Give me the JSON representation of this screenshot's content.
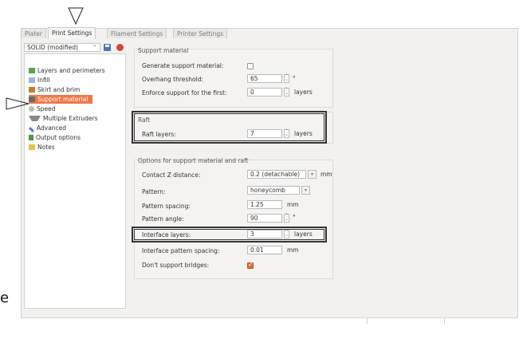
{
  "tabs": [
    "Plater",
    "Print Settings",
    "Filament Settings",
    "Printer Settings"
  ],
  "active_tab": "Print Settings",
  "preset": {
    "value": "SOLID (modified)",
    "arrow": "⌃"
  },
  "tree": [
    {
      "label": "Layers and perimeters",
      "icon": "layers-icon",
      "color": "#5aa34a"
    },
    {
      "label": "Infill",
      "icon": "infill-icon",
      "color": "#9bb6d8"
    },
    {
      "label": "Skirt and brim",
      "icon": "skirt-icon",
      "color": "#c67d2f"
    },
    {
      "label": "Support material",
      "icon": "support-icon",
      "color": "#6b6b6b",
      "selected": true
    },
    {
      "label": "Speed",
      "icon": "speed-icon",
      "color": "#8c8c8c"
    },
    {
      "label": "Multiple Extruders",
      "icon": "funnel-icon",
      "color": "#777"
    },
    {
      "label": "Advanced",
      "icon": "wrench-icon",
      "color": "#5a7dbf"
    },
    {
      "label": "Output options",
      "icon": "output-icon",
      "color": "#4a9b3a"
    },
    {
      "label": "Notes",
      "icon": "notes-icon",
      "color": "#e8c34a"
    }
  ],
  "support": {
    "title": "Support material",
    "generate_label": "Generate support material:",
    "overhang_label": "Overhang threshold:",
    "overhang_value": "65",
    "overhang_unit": "°",
    "enforce_label": "Enforce support for the first:",
    "enforce_value": "0",
    "enforce_unit": "layers"
  },
  "raft": {
    "title": "Raft",
    "layers_label": "Raft layers:",
    "layers_value": "7",
    "layers_unit": "layers"
  },
  "options": {
    "title": "Options for support material and raft",
    "contact_label": "Contact Z distance:",
    "contact_value": "0.2 (detachable)",
    "contact_unit": "mm",
    "pattern_label": "Pattern:",
    "pattern_value": "honeycomb",
    "spacing_label": "Pattern spacing:",
    "spacing_value": "1.25",
    "spacing_unit": "mm",
    "angle_label": "Pattern angle:",
    "angle_value": "90",
    "angle_unit": "°",
    "interface_label": "Interface layers:",
    "interface_value": "3",
    "interface_unit": "layers",
    "interface_spacing_label": "Interface pattern spacing:",
    "interface_spacing_value": "0.01",
    "interface_spacing_unit": "mm",
    "bridges_label": "Don't support bridges:",
    "bridges_checked": true
  },
  "stray_char": "e",
  "colors": {
    "accent": "#f07746",
    "checkbox_on": "#e06c3a"
  }
}
